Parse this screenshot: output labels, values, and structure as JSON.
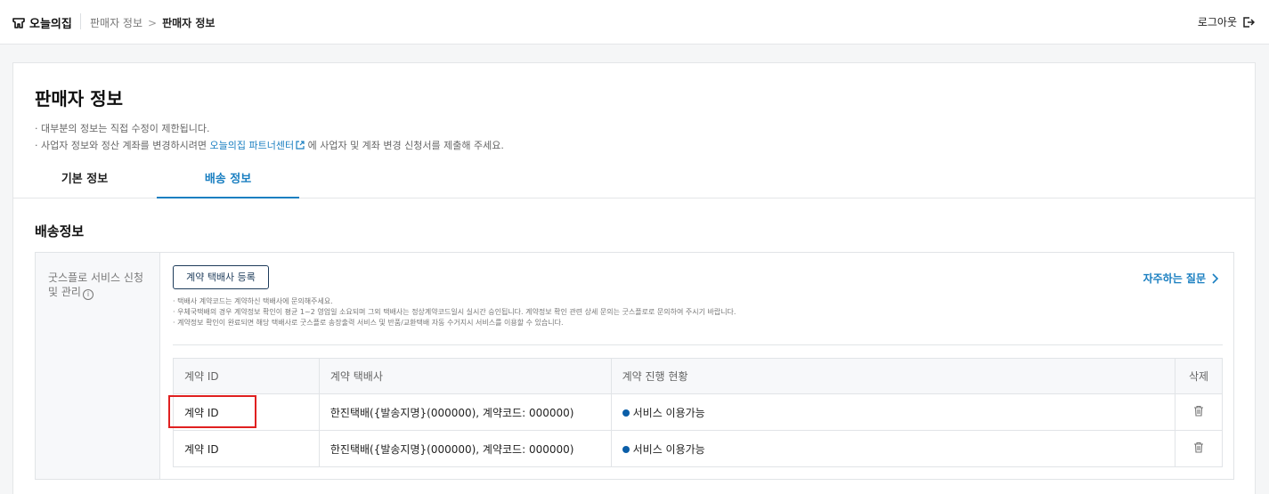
{
  "header": {
    "brand": "오늘의집",
    "breadcrumb_parent": "판매자 정보",
    "breadcrumb_sep": ">",
    "breadcrumb_current": "판매자 정보",
    "logout": "로그아웃"
  },
  "page": {
    "title": "판매자 정보",
    "note1": "· 대부분의 정보는 직접 수정이 제한됩니다.",
    "note2_prefix": "· 사업자 정보와 정산 계좌를 변경하시려면 ",
    "note2_link": "오늘의집 파트너센터",
    "note2_suffix": " 에 사업자 및 계좌 변경 신청서를 제출해 주세요."
  },
  "tabs": [
    {
      "label": "기본 정보",
      "active": false
    },
    {
      "label": "배송 정보",
      "active": true
    }
  ],
  "section": {
    "title": "배송정보",
    "label_line1": "굿스플로 서비스 신청",
    "label_line2": "및 관리",
    "info_glyph": "i",
    "register_button": "계약 택배사 등록",
    "faq_link": "자주하는 질문",
    "help": [
      "· 택배사 계약코드는 계약하신 택배사에 문의해주세요.",
      "· 우체국택배의 경우 계약정보 확인이 평균 1~2 영업일 소요되며 그외 택배사는 정상계약코드일시 실시간 승인됩니다. 계약정보 확인 관련 상세 문의는 굿스플로로 문의하여 주시기 바랍니다.",
      "· 계약정보 확인이 완료되면 해당 택배사로 굿스플로 송장출력 서비스 및 반품/교환택배 자동 수거지시 서비스를 이용할 수 있습니다."
    ]
  },
  "table": {
    "headers": [
      "계약 ID",
      "계약 택배사",
      "계약 진행 현황",
      "삭제"
    ],
    "rows": [
      {
        "id": "계약 ID",
        "carrier": "한진택배({발송지명}(000000), 계약코드: 000000)",
        "status": "서비스 이용가능"
      },
      {
        "id": "계약 ID",
        "carrier": "한진택배({발송지명}(000000), 계약코드: 000000)",
        "status": "서비스 이용가능"
      }
    ]
  },
  "colors": {
    "accent": "#1a7fc1",
    "status_dot": "#0b5ea8",
    "highlight": "#e02020"
  },
  "icons": {
    "brand": "ohouse-logo-icon",
    "logout": "logout-icon",
    "external": "external-link-icon",
    "info": "info-icon",
    "faq": "chevron-right-icon",
    "delete": "trash-icon"
  }
}
